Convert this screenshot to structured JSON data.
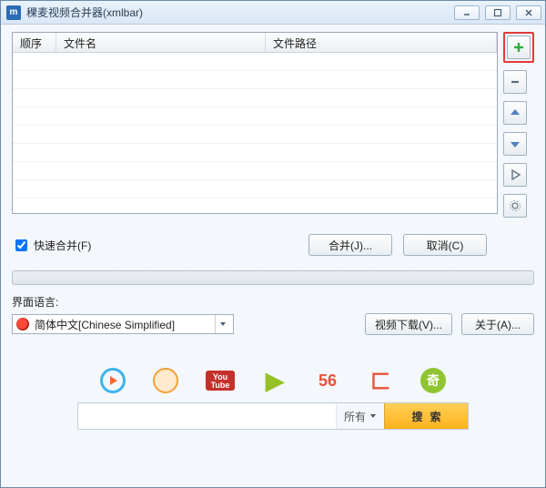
{
  "window": {
    "title": "稞麦视频合并器(xmlbar)"
  },
  "columns": {
    "order": "顺序",
    "filename": "文件名",
    "filepath": "文件路径"
  },
  "rows": [
    {
      "order": "",
      "filename": "",
      "filepath": ""
    },
    {
      "order": "",
      "filename": "",
      "filepath": ""
    },
    {
      "order": "",
      "filename": "",
      "filepath": ""
    },
    {
      "order": "",
      "filename": "",
      "filepath": ""
    },
    {
      "order": "",
      "filename": "",
      "filepath": ""
    },
    {
      "order": "",
      "filename": "",
      "filepath": ""
    },
    {
      "order": "",
      "filename": "",
      "filepath": ""
    },
    {
      "order": "",
      "filename": "",
      "filepath": ""
    }
  ],
  "actions": {
    "fast_merge_label": "快速合并(F)",
    "fast_merge_checked": true,
    "merge_label": "合并(J)...",
    "cancel_label": "取消(C)"
  },
  "language": {
    "section_label": "界面语言:",
    "selected": "简体中文[Chinese Simplified]"
  },
  "extra_buttons": {
    "download_label": "视频下载(V)...",
    "about_label": "关于(A)..."
  },
  "brands": {
    "youtube": "You\nTube",
    "n56": "56",
    "c": "匚",
    "qi": "奇"
  },
  "search": {
    "placeholder": "",
    "filter_label": "所有",
    "button_label": "搜索"
  }
}
